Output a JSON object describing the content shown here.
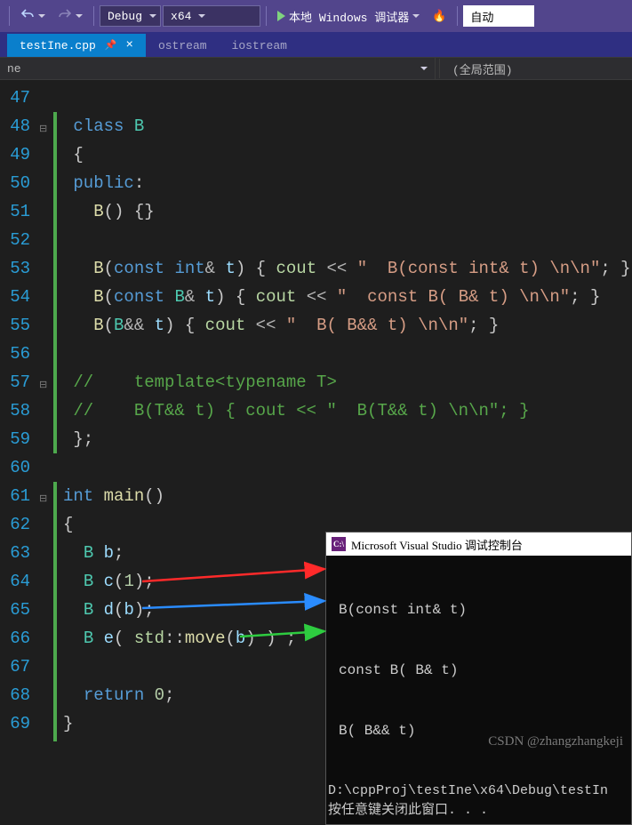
{
  "toolbar": {
    "config": "Debug",
    "platform": "x64",
    "debugger": "本地 Windows 调试器",
    "auto": "自动"
  },
  "tabs": [
    {
      "label": "testIne.cpp",
      "active": true,
      "pinned": true
    },
    {
      "label": "ostream",
      "active": false
    },
    {
      "label": "iostream",
      "active": false
    }
  ],
  "nav": {
    "left": "ne",
    "right": "(全局范围)"
  },
  "lineStart": 47,
  "lineEnd": 69,
  "code": {
    "l48": {
      "cls": "class",
      "name": "B"
    },
    "l50": {
      "kw": "public"
    },
    "l51": {
      "ctor": "B",
      "body": "() {}"
    },
    "l53": {
      "ctor": "B",
      "sig": "(const int& t)",
      "cout": "cout",
      "chev": " << ",
      "str": "\"  B(const int& t) \\n\\n\""
    },
    "l54": {
      "ctor": "B",
      "sig": "(const B& t)",
      "cout": "cout",
      "chev": " << ",
      "str": "\"  const B( B& t) \\n\\n\""
    },
    "l55": {
      "ctor": "B",
      "sig": "(B&& t)",
      "cout": "cout",
      "chev": " << ",
      "str": "\"  B( B&& t) \\n\\n\""
    },
    "l57": "//    template<typename T>",
    "l58": "//    B(T&& t) { cout << \"  B(T&& t) \\n\\n\"; }",
    "l61": {
      "ret": "int",
      "name": "main"
    },
    "l63": {
      "t": "B",
      "v": "b"
    },
    "l64": {
      "t": "B",
      "v": "c",
      "arg": "1"
    },
    "l65": {
      "t": "B",
      "v": "d",
      "arg": "b"
    },
    "l66": {
      "t": "B",
      "v": "e",
      "wrap": "std::move",
      "arg": "b"
    },
    "l68": {
      "kw": "return",
      "num": "0"
    }
  },
  "console": {
    "title": "Microsoft Visual Studio 调试控制台",
    "lines": [
      "B(const int& t)",
      "const B( B& t)",
      "B( B&& t)"
    ],
    "footer1": "D:\\cppProj\\testIne\\x64\\Debug\\testIn",
    "footer2": "按任意键关闭此窗口. . ."
  },
  "watermark": "CSDN @zhangzhangkeji"
}
